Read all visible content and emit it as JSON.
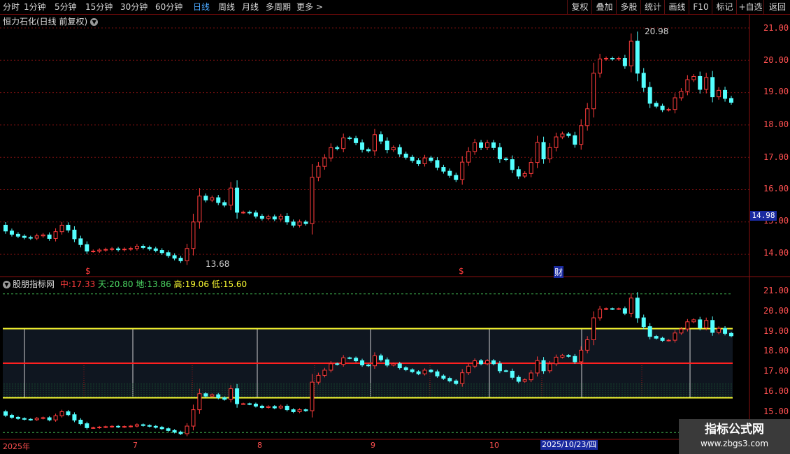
{
  "toolbar": {
    "periods": [
      "分时",
      "1分钟",
      "5分钟",
      "15分钟",
      "30分钟",
      "60分钟",
      "日线",
      "周线",
      "月线",
      "多周期",
      "更多 >"
    ],
    "active_period": "日线",
    "actions": [
      "复权",
      "叠加",
      "多股",
      "统计",
      "画线",
      "F10",
      "标记",
      "+自选",
      "返回"
    ]
  },
  "main_panel": {
    "title": "恒力石化(日线 前复权)",
    "y_ticks": [
      "21.00",
      "20.00",
      "19.00",
      "18.00",
      "17.00",
      "16.00",
      "15.00",
      "14.00"
    ],
    "current_price_tag": "14.98",
    "high_marker": "20.98",
    "low_marker": "13.68",
    "event_marks": [
      "$",
      "$",
      "财"
    ]
  },
  "indicator_panel": {
    "name": "股朋指标网",
    "values": [
      {
        "label": "中:",
        "value": "17.33",
        "color": "#ff3c3c"
      },
      {
        "label": "天:",
        "value": "20.80",
        "color": "#4cd964"
      },
      {
        "label": "地:",
        "value": "13.86",
        "color": "#4cd964"
      },
      {
        "label": "高:",
        "value": "19.06",
        "color": "#ffff33"
      },
      {
        "label": "低:",
        "value": "15.60",
        "color": "#ffff33"
      }
    ],
    "y_ticks": [
      "21.00",
      "20.00",
      "19.00",
      "18.00",
      "17.00",
      "16.00",
      "15.00"
    ]
  },
  "x_axis": {
    "labels": [
      "2025年",
      "7",
      "8",
      "9",
      "10"
    ],
    "cursor_date": "2025/10/23/四"
  },
  "watermark": {
    "line1": "指标公式网",
    "line2": "www.zbgs3.com"
  },
  "colors": {
    "up": "#ff3c3c",
    "down": "#54ffff",
    "band_high": "#ffff33",
    "mid": "#ff2020",
    "grid": "#7a1010"
  },
  "chart_data": {
    "type": "candlestick",
    "open": [
      14.9,
      14.72,
      14.62,
      14.56,
      14.52,
      14.5,
      14.57,
      14.6,
      14.49,
      14.7,
      14.9,
      14.75,
      14.48,
      14.3,
      14.1,
      14.1,
      14.13,
      14.15,
      14.17,
      14.14,
      14.16,
      14.18,
      14.25,
      14.21,
      14.17,
      14.12,
      14.05,
      13.96,
      13.88,
      13.8,
      14.18,
      15.0,
      15.8,
      15.68,
      15.75,
      15.6,
      15.52,
      16.05,
      15.3,
      15.3,
      15.28,
      15.18,
      15.11,
      15.16,
      15.09,
      15.18,
      15.0,
      14.9,
      15.0,
      14.95,
      16.38,
      16.72,
      16.98,
      17.3,
      17.27,
      17.6,
      17.58,
      17.45,
      17.24,
      17.2,
      17.7,
      17.5,
      17.23,
      17.3,
      17.1,
      17.0,
      16.9,
      16.8,
      16.98,
      16.9,
      16.69,
      16.57,
      16.44,
      16.31,
      16.85,
      17.18,
      17.45,
      17.3,
      17.45,
      17.3,
      16.95,
      16.93,
      16.62,
      16.42,
      16.5,
      16.84,
      17.46,
      16.95,
      17.3,
      17.63,
      17.72,
      17.67,
      17.4,
      17.98,
      18.5,
      19.6,
      20.04,
      20.06,
      20.04,
      20.06,
      19.83,
      20.59,
      19.6,
      19.16,
      18.67,
      18.58,
      18.47,
      18.48,
      18.84,
      19.04,
      19.4,
      19.5,
      19.1,
      19.47,
      18.87,
      19.07,
      18.82
    ],
    "close": [
      14.72,
      14.62,
      14.56,
      14.52,
      14.5,
      14.57,
      14.6,
      14.49,
      14.7,
      14.9,
      14.75,
      14.48,
      14.3,
      14.1,
      14.1,
      14.13,
      14.15,
      14.17,
      14.14,
      14.16,
      14.18,
      14.25,
      14.21,
      14.17,
      14.12,
      14.05,
      13.96,
      13.88,
      13.8,
      14.18,
      15.0,
      15.8,
      15.68,
      15.75,
      15.6,
      15.52,
      16.05,
      15.3,
      15.3,
      15.28,
      15.18,
      15.11,
      15.16,
      15.09,
      15.18,
      15.0,
      14.9,
      15.0,
      14.95,
      16.38,
      16.72,
      16.98,
      17.3,
      17.27,
      17.6,
      17.58,
      17.45,
      17.24,
      17.2,
      17.7,
      17.5,
      17.23,
      17.3,
      17.1,
      17.0,
      16.9,
      16.8,
      16.98,
      16.9,
      16.69,
      16.57,
      16.44,
      16.31,
      16.85,
      17.18,
      17.45,
      17.3,
      17.45,
      17.3,
      16.95,
      16.93,
      16.62,
      16.42,
      16.5,
      16.84,
      17.46,
      16.95,
      17.3,
      17.63,
      17.72,
      17.67,
      17.4,
      17.98,
      18.5,
      19.6,
      20.04,
      20.06,
      20.04,
      20.06,
      19.83,
      20.59,
      19.6,
      19.16,
      18.67,
      18.58,
      18.47,
      18.48,
      18.84,
      19.04,
      19.4,
      19.5,
      19.1,
      19.47,
      18.87,
      19.07,
      18.82,
      18.7
    ],
    "indicator_lines": {
      "中": 17.33,
      "天": 20.8,
      "地": 13.86,
      "高": 19.06,
      "低": 15.6
    }
  }
}
